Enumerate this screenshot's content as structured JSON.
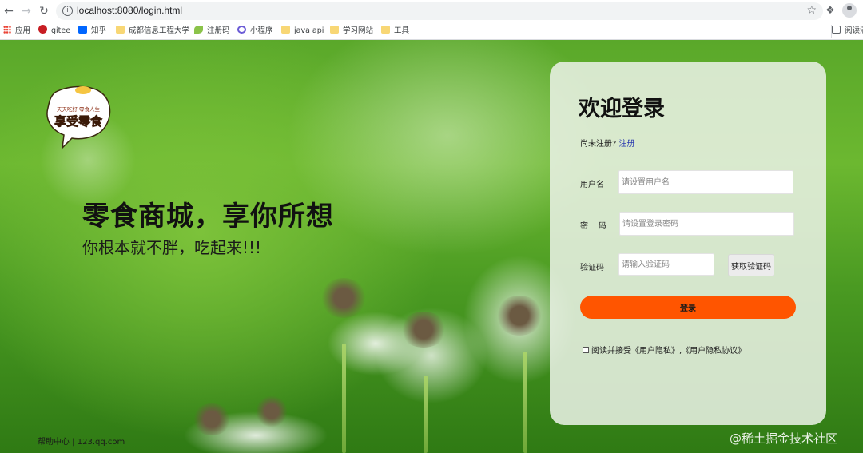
{
  "browser": {
    "url": "localhost:8080/login.html",
    "bookmarks": [
      {
        "label": "应用",
        "icon": "apps-grid-icon",
        "color": "#ea4335"
      },
      {
        "label": "gitee",
        "icon": "gitee-icon",
        "color": "#c71d23"
      },
      {
        "label": "知乎",
        "icon": "zhihu-icon",
        "color": "#0066ff"
      },
      {
        "label": "成都信息工程大学",
        "icon": "folder-icon",
        "color": "#f8d775"
      },
      {
        "label": "注册码",
        "icon": "leaf-icon",
        "color": "#8bc34a"
      },
      {
        "label": "小程序",
        "icon": "link-icon",
        "color": "#6b5bd6"
      },
      {
        "label": "java api",
        "icon": "folder-icon",
        "color": "#f8d775"
      },
      {
        "label": "学习网站",
        "icon": "folder-icon",
        "color": "#f8d775"
      },
      {
        "label": "工具",
        "icon": "folder-icon",
        "color": "#f8d775"
      }
    ],
    "reading_list": "阅读清"
  },
  "hero": {
    "logo_text_top": "天天吃好 零食人生",
    "logo_text_main": "享受零食",
    "title": "零食商城，享你所想",
    "subtitle": "你根本就不胖，吃起来!!!"
  },
  "footer": {
    "help_text": "帮助中心 | 123.qq.com"
  },
  "login": {
    "title": "欢迎登录",
    "register_prompt": "尚未注册?",
    "register_link": "注册",
    "username_label": "用户名",
    "username_placeholder": "请设置用户名",
    "password_label": "密    码",
    "password_placeholder": "请设置登录密码",
    "code_label": "验证码",
    "code_placeholder": "请输入验证码",
    "get_code_label": "获取验证码",
    "submit_label": "登录",
    "agreement_text": "阅读并接受《用户隐私》,《用户隐私协议》",
    "accent_color": "#ff5500"
  },
  "watermark": "@稀土掘金技术社区"
}
